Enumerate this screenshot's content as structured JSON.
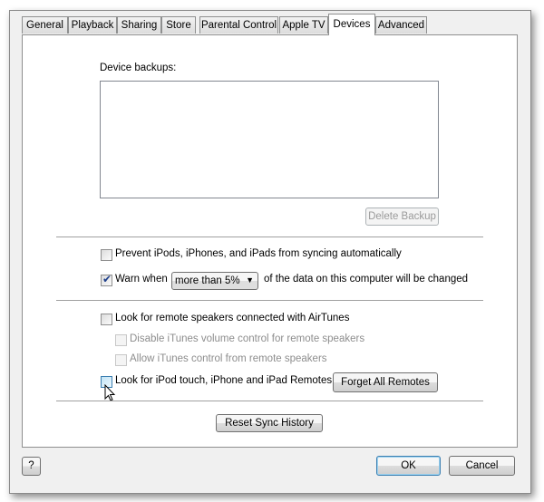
{
  "tabs": [
    {
      "label": "General"
    },
    {
      "label": "Playback"
    },
    {
      "label": "Sharing"
    },
    {
      "label": "Store"
    },
    {
      "label": "Parental Control"
    },
    {
      "label": "Apple TV"
    },
    {
      "label": "Devices",
      "active": true
    },
    {
      "label": "Advanced"
    }
  ],
  "devices": {
    "backups_label": "Device backups:",
    "backups": [],
    "delete_backup": "Delete Backup",
    "prevent_sync": {
      "label": "Prevent iPods, iPhones, and iPads from syncing automatically",
      "checked": false
    },
    "warn": {
      "label": "Warn when",
      "checked": true,
      "dropdown_value": "more than 5%",
      "suffix": "of the data on this computer will be changed"
    },
    "airtunes": {
      "label": "Look for remote speakers connected with AirTunes",
      "checked": false
    },
    "disable_volume": {
      "label": "Disable iTunes volume control for remote speakers",
      "checked": false,
      "disabled": true
    },
    "allow_control": {
      "label": "Allow iTunes control from remote speakers",
      "checked": false,
      "disabled": true
    },
    "remotes": {
      "label": "Look for iPod touch, iPhone and iPad Remotes",
      "checked": false
    },
    "forget_remotes": "Forget All Remotes",
    "reset_sync": "Reset Sync History"
  },
  "footer": {
    "help": "?",
    "ok": "OK",
    "cancel": "Cancel"
  },
  "colors": {
    "default_button_border": "#3c7fb1",
    "check_color": "#1e3f8a"
  }
}
